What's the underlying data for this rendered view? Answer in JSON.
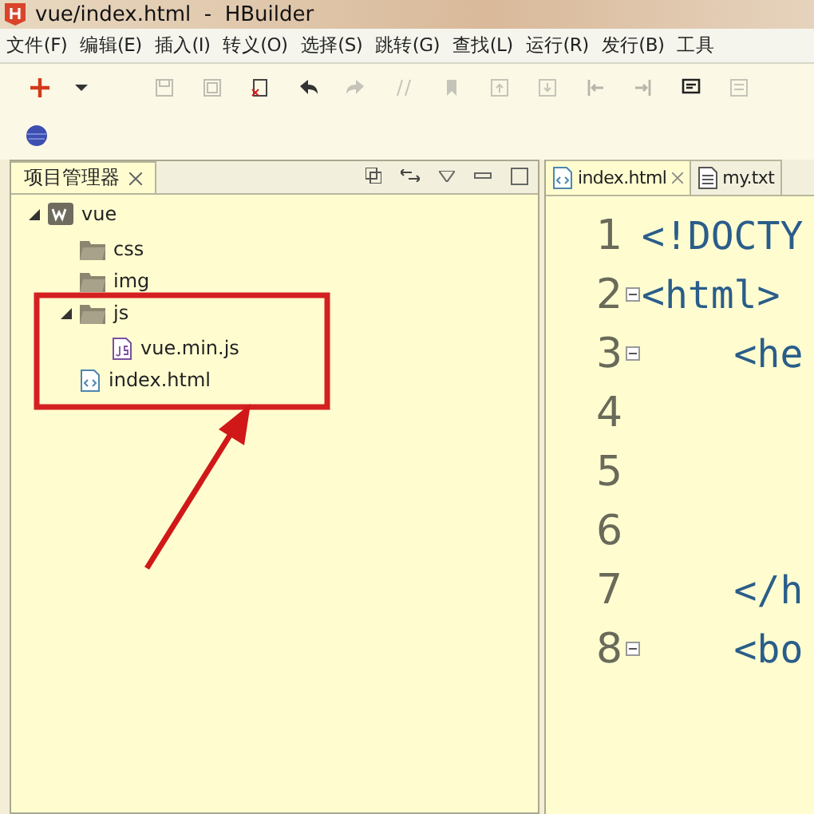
{
  "window": {
    "title": "vue/index.html  -  HBuilder"
  },
  "menu": [
    "文件(F)",
    "编辑(E)",
    "插入(I)",
    "转义(O)",
    "选择(S)",
    "跳转(G)",
    "查找(L)",
    "运行(R)",
    "发行(B)",
    "工具"
  ],
  "toolbar": [
    {
      "kind": "new",
      "disabled": false
    },
    {
      "kind": "dropdown",
      "disabled": false
    },
    {
      "kind": "save",
      "disabled": true
    },
    {
      "kind": "save-all",
      "disabled": true
    },
    {
      "kind": "close-file",
      "disabled": false
    },
    {
      "kind": "undo",
      "disabled": false
    },
    {
      "kind": "redo",
      "disabled": true
    },
    {
      "kind": "format",
      "disabled": true
    },
    {
      "kind": "bookmark",
      "disabled": true
    },
    {
      "kind": "prev-mark",
      "disabled": true
    },
    {
      "kind": "next-mark",
      "disabled": true
    },
    {
      "kind": "go-start",
      "disabled": true
    },
    {
      "kind": "go-end",
      "disabled": true
    },
    {
      "kind": "comment",
      "disabled": false
    },
    {
      "kind": "uncomment",
      "disabled": true
    }
  ],
  "project_panel": {
    "tab": {
      "label": "项目管理器",
      "selected": true
    },
    "tree": [
      {
        "kind": "project",
        "label": "vue",
        "expanded": true,
        "children": [
          {
            "kind": "folder",
            "label": "css"
          },
          {
            "kind": "folder",
            "label": "img"
          },
          {
            "kind": "folder",
            "label": "js",
            "expanded": true,
            "children": [
              {
                "kind": "js",
                "label": "vue.min.js"
              }
            ]
          },
          {
            "kind": "html",
            "label": "index.html"
          }
        ]
      }
    ]
  },
  "editor": {
    "tabs": [
      {
        "kind": "html",
        "label": "index.html",
        "selected": true
      },
      {
        "kind": "text",
        "label": "my.txt",
        "selected": false
      }
    ],
    "lines": [
      {
        "number": "1",
        "text": "<!DOCTY",
        "foldable": false
      },
      {
        "number": "2",
        "text": "<html>",
        "foldable": true
      },
      {
        "number": "3",
        "text": "    <he",
        "foldable": true
      },
      {
        "number": "4",
        "foldable": false
      },
      {
        "number": "5",
        "foldable": false
      },
      {
        "number": "6",
        "foldable": false
      },
      {
        "number": "7",
        "text": "    </h",
        "foldable": false
      },
      {
        "number": "8",
        "text": "    <bo",
        "foldable": true
      }
    ]
  }
}
